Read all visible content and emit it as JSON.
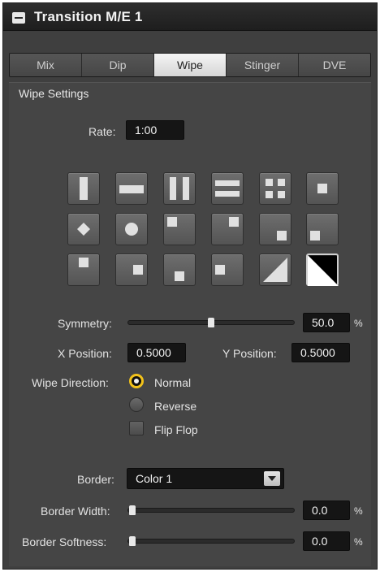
{
  "header": {
    "title": "Transition M/E 1"
  },
  "tabs": [
    {
      "label": "Mix"
    },
    {
      "label": "Dip"
    },
    {
      "label": "Wipe"
    },
    {
      "label": "Stinger"
    },
    {
      "label": "DVE"
    }
  ],
  "active_tab": "Wipe",
  "wipe_settings": {
    "title": "Wipe Settings",
    "rate_label": "Rate:",
    "rate_value": "1:00",
    "patterns": [
      "left-right-wipe",
      "top-bottom-wipe",
      "vertical-barn-door",
      "horizontal-barn-door",
      "four-box",
      "center-box",
      "diamond",
      "circle",
      "top-left-box",
      "top-center-box",
      "top-right-box",
      "bottom-right-box",
      "bottom-center-box",
      "left-center-box",
      "bottom-left-box",
      "right-center-box",
      "diagonal-box",
      "diagonal-slash"
    ],
    "selected_pattern": "diagonal-slash",
    "symmetry_label": "Symmetry:",
    "symmetry_value": "50.0",
    "symmetry_unit": "%",
    "x_position_label": "X Position:",
    "x_position_value": "0.5000",
    "y_position_label": "Y Position:",
    "y_position_value": "0.5000",
    "wipe_direction_label": "Wipe Direction:",
    "direction_normal": "Normal",
    "direction_reverse": "Reverse",
    "direction_selected": "Normal",
    "flip_flop_label": "Flip Flop",
    "flip_flop_checked": false,
    "border_label": "Border:",
    "border_value": "Color 1",
    "border_width_label": "Border Width:",
    "border_width_value": "0.0",
    "border_width_unit": "%",
    "border_softness_label": "Border Softness:",
    "border_softness_value": "0.0",
    "border_softness_unit": "%"
  },
  "colors": {
    "panel_bg": "#3f3f3f",
    "field_bg": "#151515",
    "radio_accent": "#f2c21b",
    "active_tab_bg": "#e6e6e6"
  }
}
